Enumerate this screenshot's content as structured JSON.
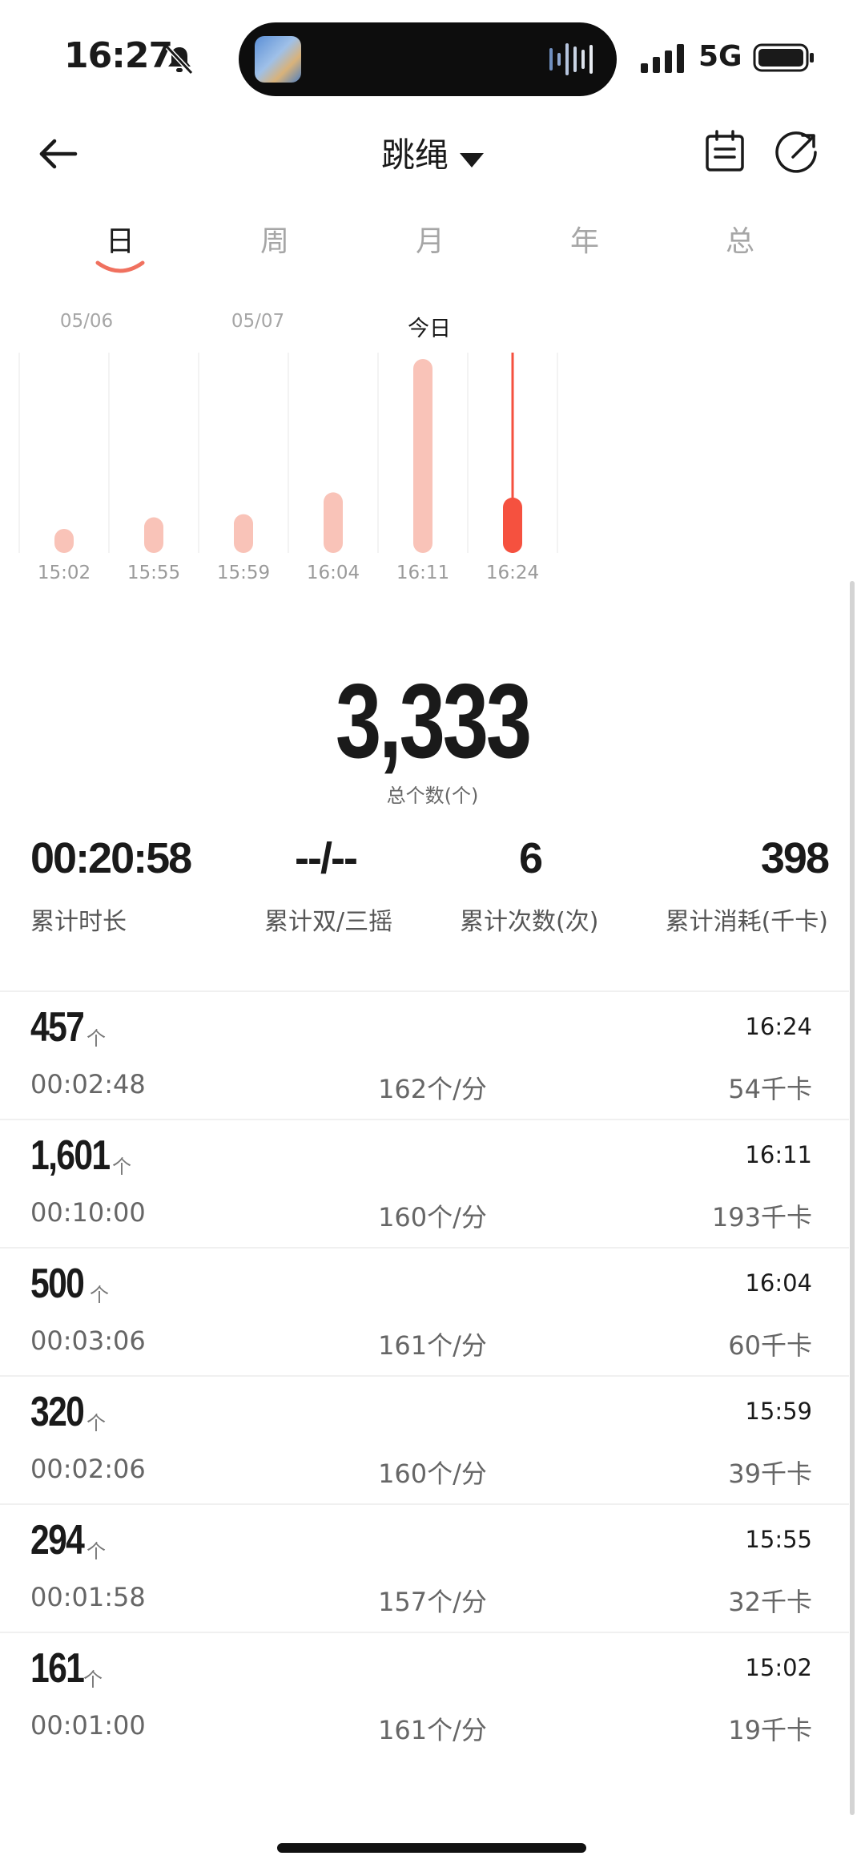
{
  "status": {
    "time": "16:27",
    "network": "5G"
  },
  "header": {
    "title": "跳绳"
  },
  "tabs": [
    "日",
    "周",
    "月",
    "年",
    "总"
  ],
  "dates": [
    "05/06",
    "05/07",
    "今日"
  ],
  "colors": {
    "accent": "#f5513f",
    "bar_light": "#f9c3b8",
    "tab_underline": "#f0715f"
  },
  "chart_data": {
    "type": "bar",
    "categories": [
      "15:02",
      "15:55",
      "15:59",
      "16:04",
      "16:11",
      "16:24"
    ],
    "values": [
      161,
      294,
      320,
      500,
      1601,
      457
    ],
    "selected_index": 5,
    "grid": true
  },
  "summary": {
    "total": "3,333",
    "total_label": "总个数(个)",
    "duration": "00:20:58",
    "duration_label": "累计时长",
    "double": "--/--",
    "double_label": "累计双/三摇",
    "sessions": "6",
    "sessions_label": "累计次数(次)",
    "calories": "398",
    "calories_label": "累计消耗(千卡)"
  },
  "records": [
    {
      "count": "457",
      "unit": "个",
      "time": "16:24",
      "duration": "00:02:48",
      "pace": "162个/分",
      "kcal": "54千卡"
    },
    {
      "count": "1,601",
      "unit": "个",
      "time": "16:11",
      "duration": "00:10:00",
      "pace": "160个/分",
      "kcal": "193千卡"
    },
    {
      "count": "500",
      "unit": "个",
      "time": "16:04",
      "duration": "00:03:06",
      "pace": "161个/分",
      "kcal": "60千卡"
    },
    {
      "count": "320",
      "unit": "个",
      "time": "15:59",
      "duration": "00:02:06",
      "pace": "160个/分",
      "kcal": "39千卡"
    },
    {
      "count": "294",
      "unit": "个",
      "time": "15:55",
      "duration": "00:01:58",
      "pace": "157个/分",
      "kcal": "32千卡"
    },
    {
      "count": "161",
      "unit": "个",
      "time": "15:02",
      "duration": "00:01:00",
      "pace": "161个/分",
      "kcal": "19千卡"
    }
  ]
}
